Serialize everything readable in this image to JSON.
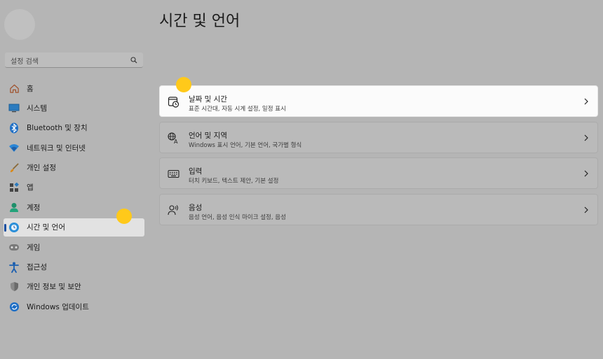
{
  "search": {
    "placeholder": "설정 검색"
  },
  "sidebar": {
    "items": [
      {
        "label": "홈",
        "icon": "home-icon"
      },
      {
        "label": "시스템",
        "icon": "monitor-icon"
      },
      {
        "label": "Bluetooth 및 장치",
        "icon": "bluetooth-icon"
      },
      {
        "label": "네트워크 및 인터넷",
        "icon": "wifi-icon"
      },
      {
        "label": "개인 설정",
        "icon": "brush-icon"
      },
      {
        "label": "앱",
        "icon": "apps-icon"
      },
      {
        "label": "계정",
        "icon": "person-icon"
      },
      {
        "label": "시간 및 언어",
        "icon": "globe-clock-icon",
        "selected": true
      },
      {
        "label": "게임",
        "icon": "gamepad-icon"
      },
      {
        "label": "접근성",
        "icon": "accessibility-icon"
      },
      {
        "label": "개인 정보 및 보안",
        "icon": "shield-icon"
      },
      {
        "label": "Windows 업데이트",
        "icon": "update-icon"
      }
    ]
  },
  "main": {
    "title": "시간 및 언어",
    "cards": [
      {
        "title": "날짜 및 시간",
        "subtitle": "표준 시간대, 자동 시계 설정, 일정 표시",
        "icon": "calendar-clock-icon"
      },
      {
        "title": "언어 및 지역",
        "subtitle": "Windows 표시 언어, 기본 언어, 국가별 형식",
        "icon": "language-icon"
      },
      {
        "title": "입력",
        "subtitle": "터치 키보드, 텍스트 제안, 기본 설정",
        "icon": "keyboard-icon"
      },
      {
        "title": "음성",
        "subtitle": "음성 언어, 음성 인식 마이크 설정, 음성",
        "icon": "speech-icon"
      }
    ]
  },
  "colors": {
    "accent": "#1b4fa0",
    "highlight_dot": "#ffc91a",
    "background": "#b5b5b5"
  }
}
